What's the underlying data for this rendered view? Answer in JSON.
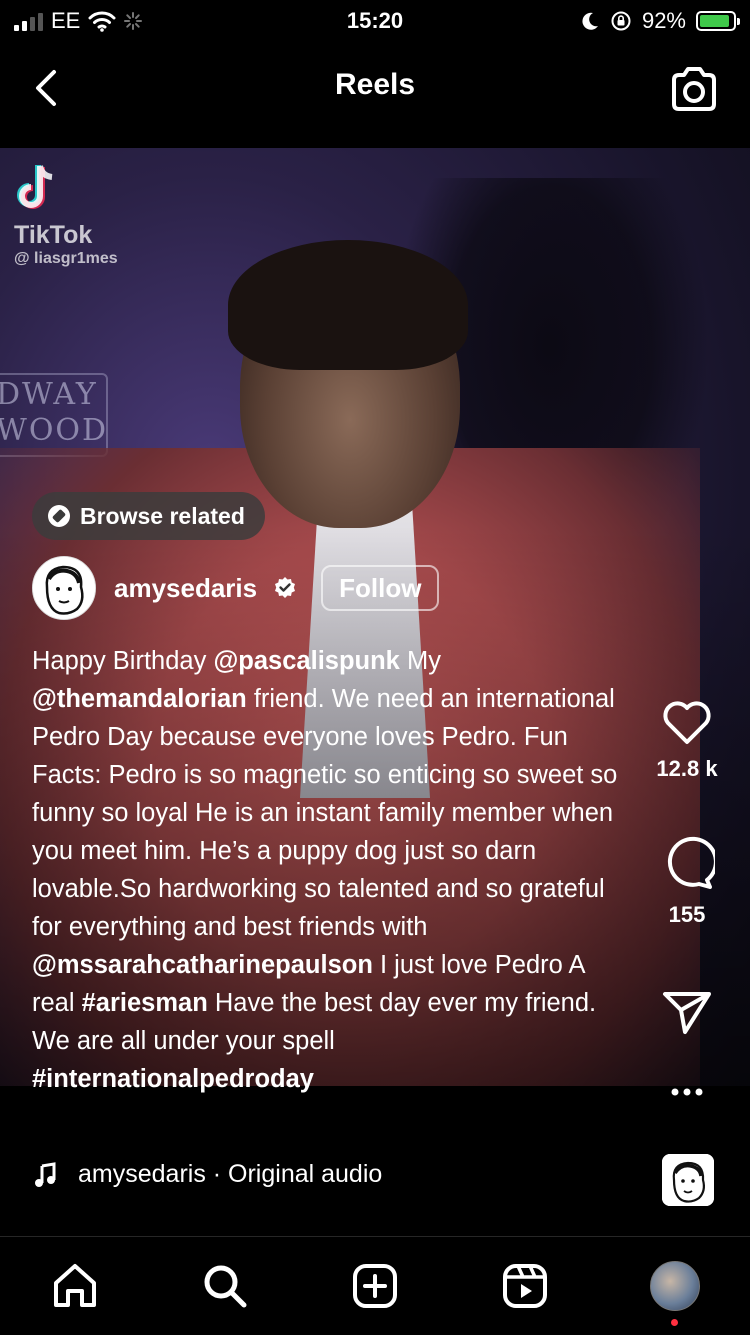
{
  "status_bar": {
    "carrier": "EE",
    "time": "15:20",
    "battery_percent": "92%",
    "battery_level": 0.92,
    "battery_color": "#3fc94a"
  },
  "header": {
    "title": "Reels"
  },
  "video": {
    "watermark_brand": "TikTok",
    "watermark_handle": "@ liasgr1mes",
    "sign_text_line1": "DWAY",
    "sign_text_line2": "WOOD"
  },
  "browse_related": {
    "label": "Browse related"
  },
  "author": {
    "username": "amysedaris",
    "follow_label": "Follow"
  },
  "caption": {
    "segments": [
      {
        "text": "Happy Birthday ",
        "bold": false
      },
      {
        "text": "@pascalispunk",
        "bold": true
      },
      {
        "text": " My ",
        "bold": false
      },
      {
        "text": "@themandalorian",
        "bold": true
      },
      {
        "text": " friend. We need an international Pedro Day because everyone loves Pedro. Fun Facts: Pedro is so magnetic so enticing so sweet so funny so loyal He is an instant family member when you meet him. He’s a puppy dog just so darn lovable.So hardworking so talented and so grateful for everything and best friends with ",
        "bold": false
      },
      {
        "text": "@mssarahcatharinepaulson",
        "bold": true
      },
      {
        "text": " I just love Pedro A real ",
        "bold": false
      },
      {
        "text": "#ariesman",
        "bold": true
      },
      {
        "text": " Have the best day ever my friend. We are all under your spell ",
        "bold": false
      },
      {
        "text": "#internationalpedroday",
        "bold": true
      }
    ]
  },
  "actions": {
    "likes": "12.8 k",
    "comments": "155"
  },
  "audio": {
    "label": "amysedaris · Original audio"
  },
  "bottom_nav": {
    "items": [
      "home-icon",
      "search-icon",
      "create-icon",
      "reels-icon",
      "profile-avatar"
    ],
    "notification_dot_color": "#ff3040"
  }
}
